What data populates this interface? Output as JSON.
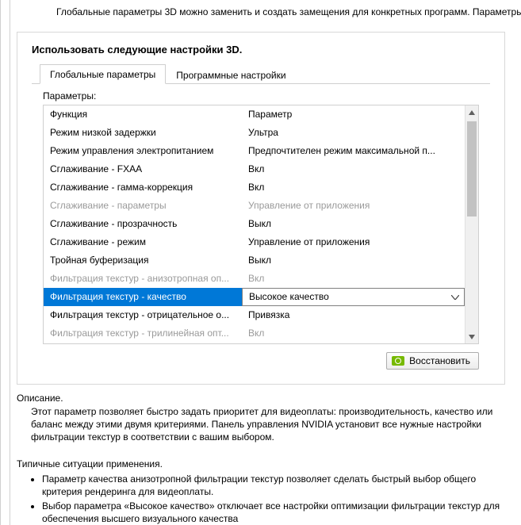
{
  "top_text": "Глобальные параметры 3D можно заменить и создать замещения для конкретных программ. Параметры замеще",
  "panel": {
    "title": "Использовать следующие настройки 3D.",
    "tabs": {
      "global": "Глобальные параметры",
      "program": "Программные настройки"
    },
    "params_label": "Параметры:",
    "header": {
      "func": "Функция",
      "param": "Параметр"
    },
    "rows": [
      {
        "func": "Режим низкой задержки",
        "param": "Ультра",
        "disabled": false,
        "selected": false
      },
      {
        "func": "Режим управления электропитанием",
        "param": "Предпочтителен режим максимальной п...",
        "disabled": false,
        "selected": false
      },
      {
        "func": "Сглаживание - FXAA",
        "param": "Вкл",
        "disabled": false,
        "selected": false
      },
      {
        "func": "Сглаживание - гамма-коррекция",
        "param": "Вкл",
        "disabled": false,
        "selected": false
      },
      {
        "func": "Сглаживание - параметры",
        "param": "Управление от приложения",
        "disabled": true,
        "selected": false
      },
      {
        "func": "Сглаживание - прозрачность",
        "param": "Выкл",
        "disabled": false,
        "selected": false
      },
      {
        "func": "Сглаживание - режим",
        "param": "Управление от приложения",
        "disabled": false,
        "selected": false
      },
      {
        "func": "Тройная буферизация",
        "param": "Выкл",
        "disabled": false,
        "selected": false
      },
      {
        "func": "Фильтрация текстур - анизотропная оп...",
        "param": "Вкл",
        "disabled": true,
        "selected": false
      },
      {
        "func": "Фильтрация текстур - качество",
        "param": "Высокое качество",
        "disabled": false,
        "selected": true
      },
      {
        "func": "Фильтрация текстур - отрицательное о...",
        "param": "Привязка",
        "disabled": false,
        "selected": false
      },
      {
        "func": "Фильтрация текстур - трилинейная опт...",
        "param": "Вкл",
        "disabled": true,
        "selected": false
      }
    ],
    "restore_label": "Восстановить"
  },
  "description": {
    "title": "Описание.",
    "body": "Этот параметр позволяет быстро задать приоритет для видеоплаты: производительность, качество или баланс между этими двумя критериями. Панель управления NVIDIA установит все нужные настройки фильтрации текстур в соответствии с вашим выбором."
  },
  "usage": {
    "title": "Типичные ситуации применения.",
    "items": [
      "Параметр качества анизотропной фильтрации текстур позволяет сделать быстрый выбор общего критерия рендеринга для видеоплаты.",
      "Выбор параметра «Высокое качество» отключает все настройки оптимизации фильтрации текстур для обеспечения высшего визуального качества"
    ]
  }
}
